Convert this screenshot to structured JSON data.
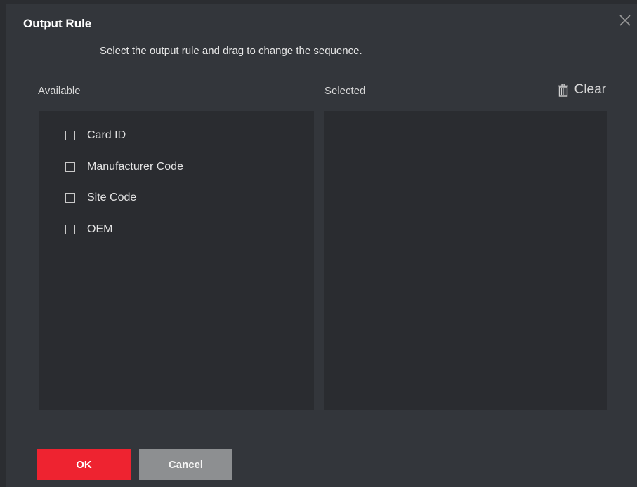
{
  "dialog": {
    "title": "Output Rule",
    "instruction": "Select the output rule and drag to change the sequence."
  },
  "available": {
    "label": "Available",
    "items": [
      {
        "label": "Card ID",
        "checked": false
      },
      {
        "label": "Manufacturer Code",
        "checked": false
      },
      {
        "label": "Site Code",
        "checked": false
      },
      {
        "label": "OEM",
        "checked": false
      }
    ]
  },
  "selected": {
    "label": "Selected",
    "items": []
  },
  "actions": {
    "clear_label": "Clear",
    "clear_icon": "trash-icon",
    "close_icon": "close-icon",
    "ok_label": "OK",
    "cancel_label": "Cancel"
  },
  "colors": {
    "background": "#33363b",
    "panel": "#2a2c30",
    "ok_button": "#ee2330",
    "cancel_button": "#8d8f91"
  }
}
